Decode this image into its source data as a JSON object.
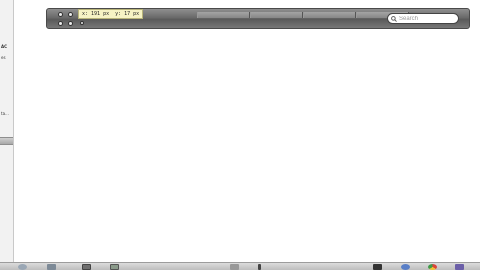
{
  "sidebar": {
    "texts": [
      "AC",
      "es",
      "ta..."
    ]
  },
  "toolbar": {
    "coords": {
      "x_label": "x: 191 px",
      "y_label": "y: 17 px"
    },
    "search": {
      "placeholder": "Search",
      "value": ""
    }
  },
  "dock": {
    "icons": [
      "finder-icon",
      "folder-icon",
      "monitor-icon",
      "grid-icon",
      "trash-icon",
      "pen-icon",
      "terminal-icon",
      "globe-icon",
      "chrome-icon",
      "lightning-icon"
    ]
  }
}
